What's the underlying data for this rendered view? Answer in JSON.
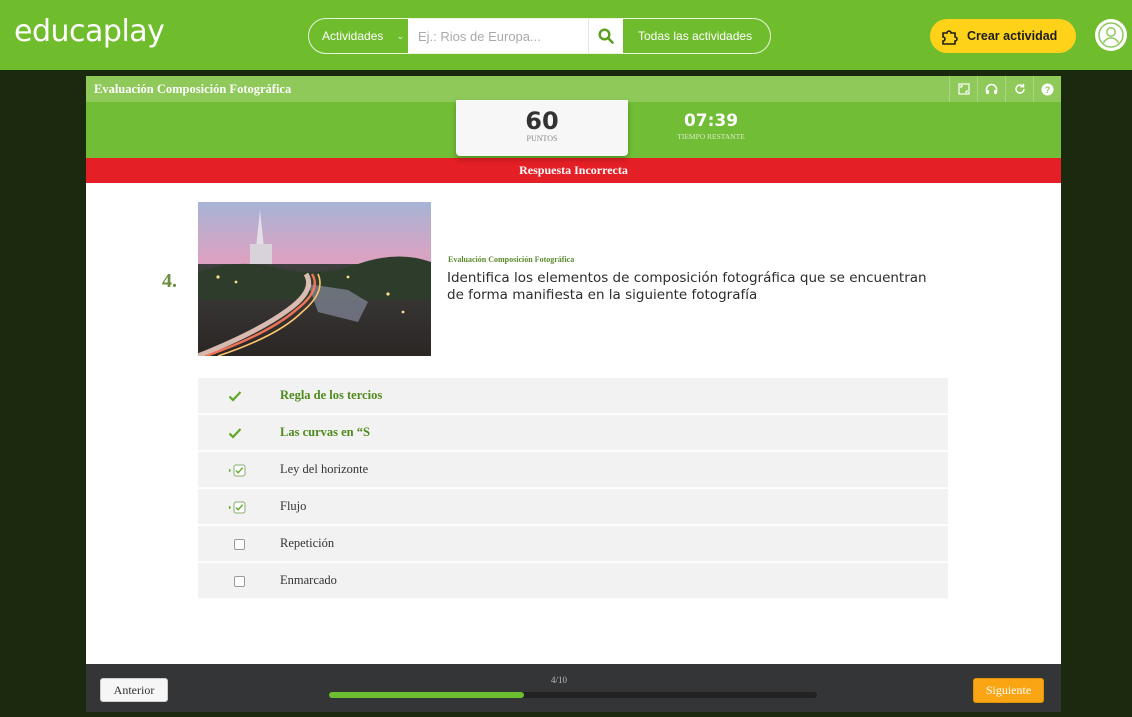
{
  "header": {
    "logo_a": "educa",
    "logo_b": "play",
    "search": {
      "category": "Actividades",
      "placeholder": "Ej.: Rios de Europa...",
      "all_activities": "Todas las actividades"
    },
    "create_button": "Crear actividad"
  },
  "activity": {
    "title": "Evaluación Composición Fotográfica",
    "score": "60",
    "score_label": "PUNTOS",
    "time": "07:39",
    "time_label": "TIEMPO RESTANTE",
    "feedback": "Respuesta Incorrecta"
  },
  "question": {
    "number": "4.",
    "subtitle": "Evaluación Composición Fotográfica",
    "text": "Identifica los elementos de composición fotográfica que se encuentran de forma manifiesta en la siguiente fotografía",
    "options": [
      {
        "label": "Regla de los tercios",
        "state": "correct"
      },
      {
        "label": "Las curvas en “S",
        "state": "correct"
      },
      {
        "label": "Ley del horizonte",
        "state": "checked-wrong"
      },
      {
        "label": "Flujo",
        "state": "checked-wrong"
      },
      {
        "label": "Repetición",
        "state": "unchecked"
      },
      {
        "label": "Enmarcado",
        "state": "unchecked"
      }
    ]
  },
  "footer": {
    "prev": "Anterior",
    "next": "Siguiente",
    "progress_text": "4/10",
    "progress_fraction": 0.4
  },
  "colors": {
    "brand_green": "#6fbc2d",
    "error_red": "#e41f25",
    "accent_yellow": "#ffd21a",
    "next_orange": "#f9a514"
  }
}
